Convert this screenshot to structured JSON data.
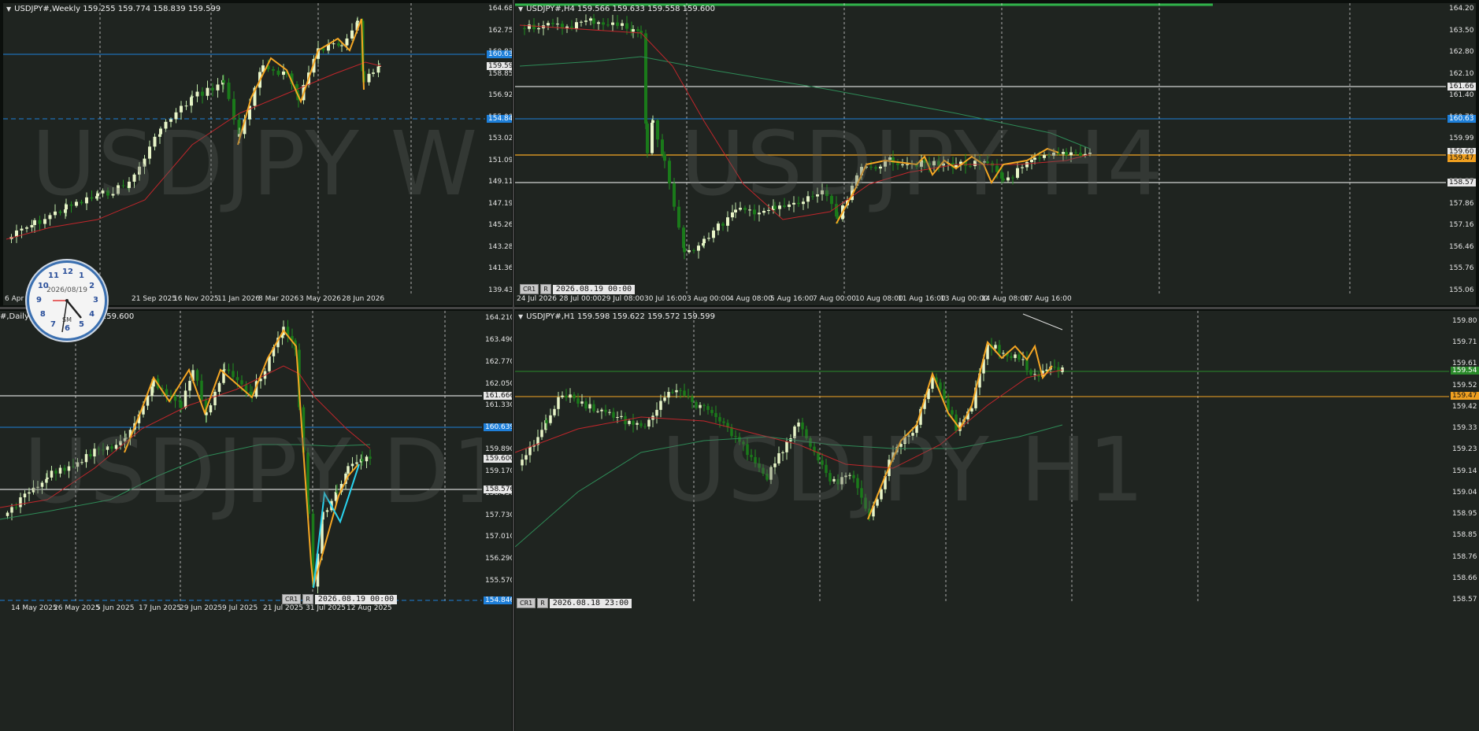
{
  "weekly": {
    "header": "USDJPY#,Weekly  159.255 159.774 158.839 159.599",
    "watermark": "USDJPY W1",
    "prices": [
      "164.680",
      "162.755",
      "160.830",
      "158.850",
      "156.925",
      "155.000",
      "153.020",
      "151.095",
      "149.115",
      "147.190",
      "145.265",
      "143.285",
      "141.360",
      "139.435"
    ],
    "tags": [
      {
        "text": "160.639",
        "kind": "blue"
      },
      {
        "text": "159.599",
        "kind": "white"
      },
      {
        "text": "154.846",
        "kind": "blue"
      }
    ],
    "times": [
      "6 Apr",
      "25 Jul 2025",
      "21 Sep 2025",
      "16 Nov 2025",
      "11 Jan 2026",
      "8 Mar 2026",
      "3 May 2026",
      "28 Jun 2026"
    ]
  },
  "h4": {
    "header": "USDJPY#,H4  159.566 159.633 159.558 159.600",
    "watermark": "USDJPY H4",
    "prices": [
      "164.20",
      "163.50",
      "162.80",
      "162.10",
      "161.40",
      "160.70",
      "159.99",
      "159.28",
      "158.57",
      "157.86",
      "157.16",
      "156.46",
      "155.76",
      "155.06"
    ],
    "tags": [
      {
        "text": "161.66",
        "kind": "white"
      },
      {
        "text": "160.63",
        "kind": "blue"
      },
      {
        "text": "159.60",
        "kind": "white"
      },
      {
        "text": "159.47",
        "kind": "orange"
      },
      {
        "text": "158.57",
        "kind": "white"
      }
    ],
    "times": [
      "24 Jul 2026",
      "28 Jul 00:00",
      "29 Jul 08:00",
      "30 Jul 16:00",
      "3 Aug 00:00",
      "4 Aug 08:00",
      "5 Aug 16:00",
      "7 Aug 00:00",
      "10 Aug 08:00",
      "11 Aug 16:00",
      "13 Aug 00:00",
      "14 Aug 08:00",
      "17 Aug 16:00"
    ],
    "box": {
      "btn1": "CR1",
      "btn2": "R",
      "value": "2026.08.19 00:00"
    }
  },
  "daily": {
    "header": "#,Daily",
    "header_tail": "159.600",
    "watermark": "USDJPY D1",
    "prices": [
      "164.210",
      "163.490",
      "162.770",
      "162.050",
      "161.330",
      "160.610",
      "159.890",
      "159.170",
      "158.450",
      "157.730",
      "157.010",
      "156.290",
      "155.570"
    ],
    "tags": [
      {
        "text": "161.666",
        "kind": "white"
      },
      {
        "text": "160.639",
        "kind": "blue"
      },
      {
        "text": "159.600",
        "kind": "white"
      },
      {
        "text": "158.576",
        "kind": "white"
      },
      {
        "text": "154.846",
        "kind": "blue"
      }
    ],
    "times": [
      "14 May 2025",
      "26 May 2025",
      "5 Jun 2025",
      "17 Jun 2025",
      "29 Jun 2025",
      "9 Jul 2025",
      "21 Jul 2025",
      "31 Jul 2025",
      "12 Aug 2025"
    ],
    "box": {
      "btn1": "CR1",
      "btn2": "R",
      "value": "2026.08.19 00:00"
    }
  },
  "h1": {
    "header": "USDJPY#,H1  159.598 159.622 159.572 159.599",
    "watermark": "USDJPY H1",
    "prices": [
      "159.80",
      "159.71",
      "159.61",
      "159.52",
      "159.42",
      "159.33",
      "159.23",
      "159.14",
      "159.04",
      "158.95",
      "158.85",
      "158.76",
      "158.66",
      "158.57"
    ],
    "tags": [
      {
        "text": "159.54",
        "kind": "green"
      },
      {
        "text": "159.47",
        "kind": "orange"
      }
    ],
    "box": {
      "btn1": "CR1",
      "btn2": "R",
      "value": "2026.08.18 23:00"
    }
  },
  "clock": {
    "date": "2026/08/19",
    "brand": "SM",
    "numbers": [
      "12",
      "1",
      "2",
      "3",
      "4",
      "5",
      "6",
      "7",
      "8",
      "9",
      "10",
      "11"
    ]
  },
  "colors": {
    "bg": "#1f2420",
    "bull": "#e8f5c8",
    "bear": "#1a7a1a",
    "orange": "#f5a623",
    "red": "#c0262b",
    "green_ma": "#2e8b57",
    "blue_line": "#1e7fd9",
    "cyan": "#29d4f0"
  }
}
